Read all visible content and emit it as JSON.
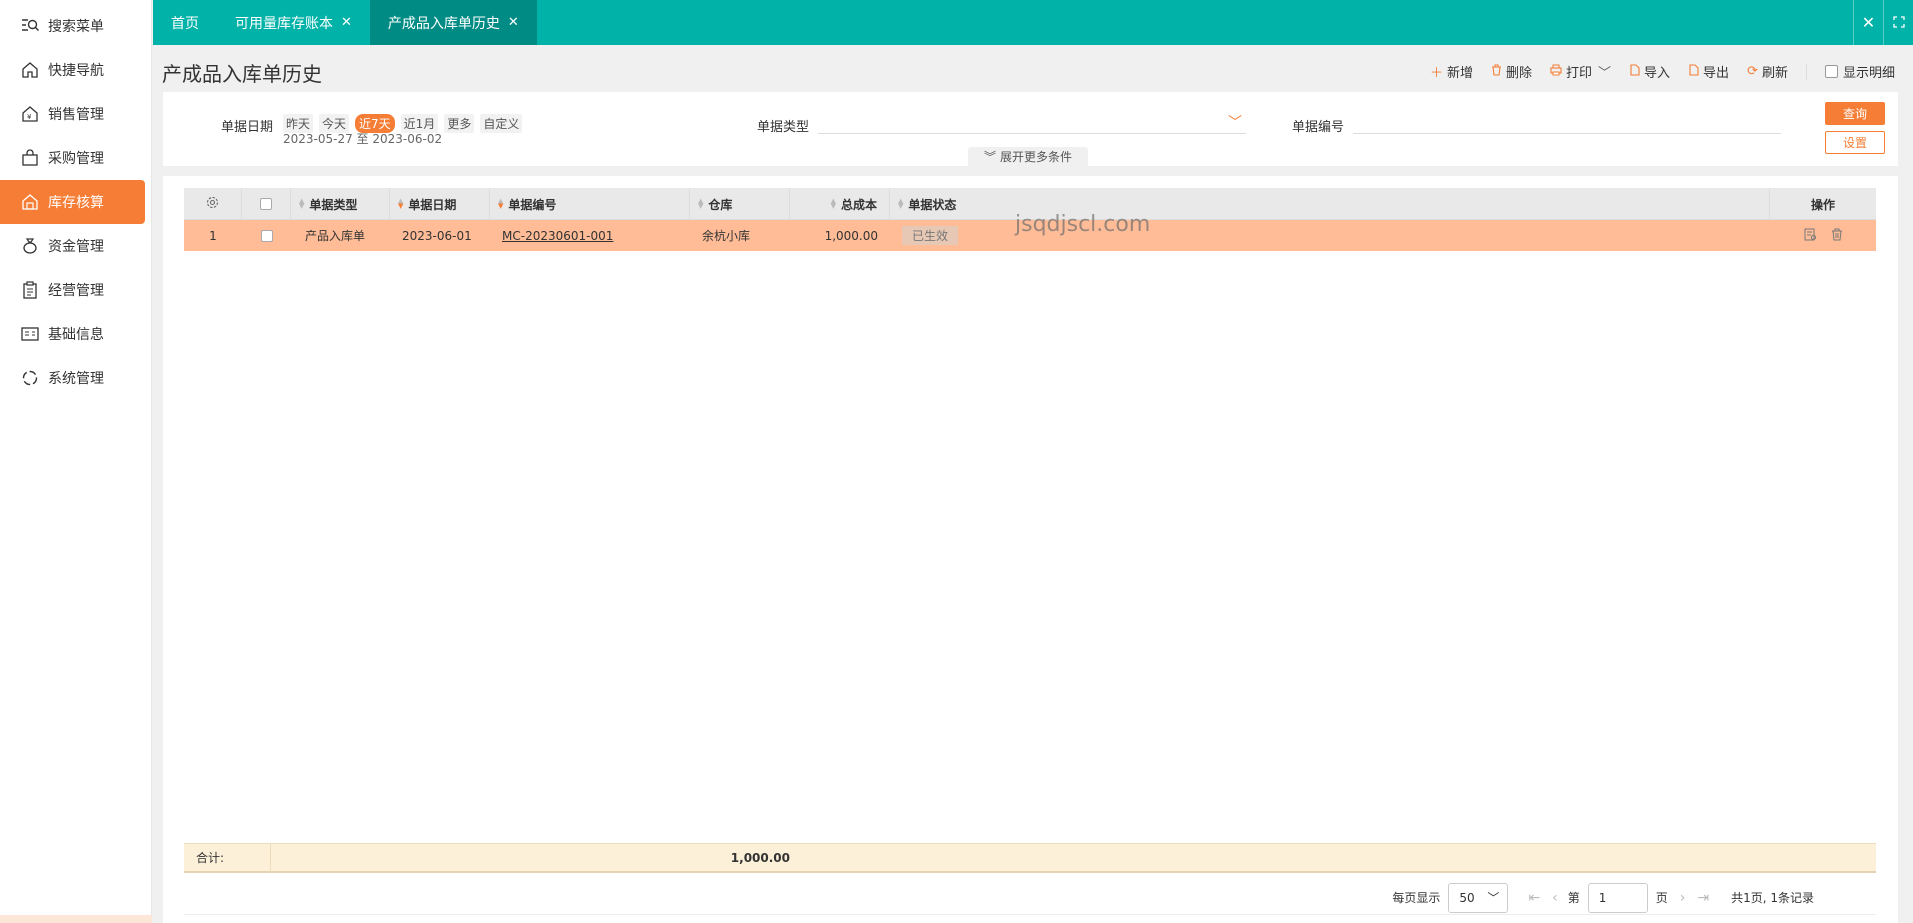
{
  "sidebar": {
    "items": [
      {
        "label": "搜索菜单",
        "icon": "search-menu-icon"
      },
      {
        "label": "快捷导航",
        "icon": "home-icon"
      },
      {
        "label": "销售管理",
        "icon": "sales-icon"
      },
      {
        "label": "采购管理",
        "icon": "bag-icon"
      },
      {
        "label": "库存核算",
        "icon": "warehouse-icon"
      },
      {
        "label": "资金管理",
        "icon": "money-bag-icon"
      },
      {
        "label": "经营管理",
        "icon": "clipboard-icon"
      },
      {
        "label": "基础信息",
        "icon": "id-card-icon"
      },
      {
        "label": "系统管理",
        "icon": "settings-ring-icon"
      }
    ]
  },
  "tabs": [
    {
      "label": "首页"
    },
    {
      "label": "可用量库存账本"
    },
    {
      "label": "产成品入库单历史"
    }
  ],
  "page": {
    "title": "产成品入库单历史"
  },
  "toolbar": {
    "add": "新增",
    "delete": "删除",
    "print": "打印",
    "import": "导入",
    "export": "导出",
    "refresh": "刷新",
    "show_detail": "显示明细"
  },
  "filter": {
    "date_label": "单据日期",
    "chips": [
      "昨天",
      "今天",
      "近7天",
      "近1月",
      "更多",
      "自定义"
    ],
    "date_range": "2023-05-27 至 2023-06-02",
    "type_label": "单据类型",
    "type_value": "",
    "number_label": "单据编号",
    "number_value": "",
    "query": "查询",
    "settings": "设置",
    "expand": "展开更多条件"
  },
  "table": {
    "headers": {
      "type": "单据类型",
      "date": "单据日期",
      "number": "单据编号",
      "warehouse": "仓库",
      "cost": "总成本",
      "status": "单据状态",
      "actions": "操作"
    },
    "rows": [
      {
        "index": "1",
        "type": "产品入库单",
        "date": "2023-06-01",
        "number": "MC-20230601-001",
        "warehouse": "余杭小库",
        "cost": "1,000.00",
        "status": "已生效"
      }
    ],
    "sum_label": "合计:",
    "sum_cost": "1,000.00"
  },
  "pager": {
    "per_page_label": "每页显示",
    "per_page": "50",
    "page_prefix": "第",
    "page": "1",
    "page_suffix": "页",
    "summary": "共1页, 1条记录"
  },
  "watermark": "jsqdjscl.com",
  "colors": {
    "accent": "#f57d35",
    "topbar": "#00b2a7",
    "active_tab": "#008c84",
    "row_highlight": "#ffbc97"
  }
}
